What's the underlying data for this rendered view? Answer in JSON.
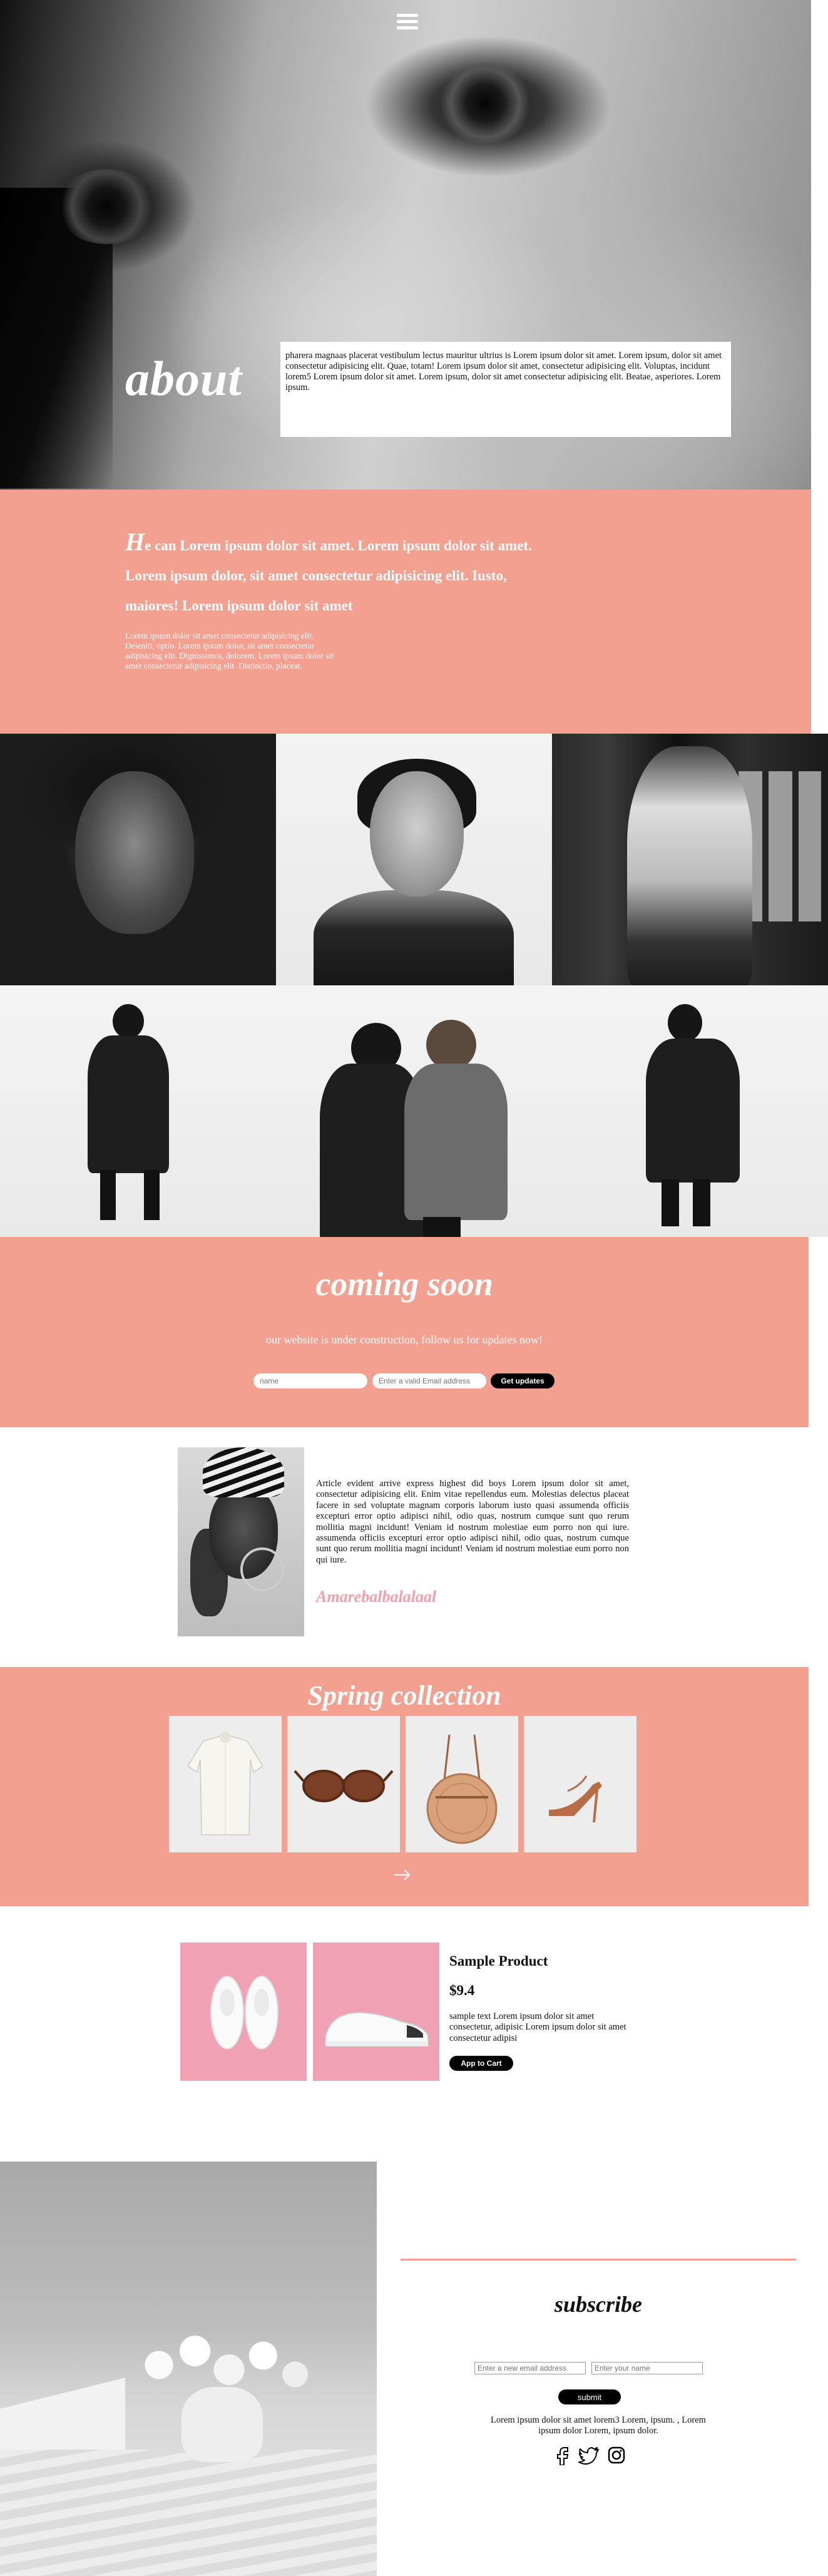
{
  "hero": {
    "title": "about",
    "body": "pharera magnaas placerat vestibulum lectus mauritur ultrius is Lorem ipsum dolor sit amet. Lorem ipsum, dolor sit amet consectetur adipisicing elit. Quae, totam! Lorem ipsum dolor sit amet, consectetur adipisicing elit. Voluptas, incidunt lorem5 Lorem ipsum dolor sit amet. Lorem ipsum, dolor sit amet consectetur adipisicing elit. Beatae, asperiores. Lorem ipsum."
  },
  "intro": {
    "dropcap": "H",
    "lead": "e can Lorem ipsum dolor sit amet. Lorem ipsum dolor sit amet. Lorem ipsum dolor, sit amet consectetur adipisicing elit. Iusto, maiores! Lorem ipsum dolor sit amet",
    "small": "Lorem ipsum dolor sit amet consectetur adipisicing elit. Deleniti, optio. Lorem ipsum dolor, sit amet consectetur adipisicing elit. Dignissimos, dolorem. Lorem ipsum dolor sit amet consectetur adipisicing elit. Distinctio, placeat."
  },
  "coming_soon": {
    "title": "coming soon",
    "subtitle": "our website is under construction, follow us for updates now!",
    "name_placeholder": "name",
    "email_placeholder": "Enter a valid Email address",
    "button": "Get updates"
  },
  "article": {
    "text": "Article evident arrive express highest did boys Lorem ipsum dolor sit amet, consectetur adipisicing elit. Enim vitae repellendus eum. Molestias delectus placeat facere in sed voluptate magnam corporis laborum iusto quasi assumenda officiis excepturi error optio adipisci nihil, odio quas, nostrum cumque sunt quo rerum mollitia magni incidunt! Veniam id nostrum molestiae eum porro non qui iure. assumenda officiis excepturi error optio adipisci nihil, odio quas, nostrum cumque sunt quo rerum mollitia magni incidunt! Veniam id nostrum molestiae eum porro non qui iure.",
    "signature": "Amarebalbalalaal"
  },
  "spring": {
    "title": "Spring collection"
  },
  "product": {
    "title": "Sample Product",
    "price": "$9.4",
    "description": "sample text Lorem ipsum dolor sit amet consectetur, adipisic Lorem ipsum dolor sit amet consectetur adipisi",
    "button": "App to Cart"
  },
  "subscribe": {
    "title": "subscribe",
    "email_placeholder": "Enter a new email address",
    "name_placeholder": "Enter your name",
    "button": "submit",
    "text": "Lorem ipsum dolor sit amet lorem3 Lorem, ipsum. , Lorem ipsum dolor Lorem, ipsum dolor."
  },
  "icons": {
    "menu": "hamburger-menu-icon",
    "arrow": "arrow-right-icon",
    "social": [
      "facebook-icon",
      "twitter-icon",
      "instagram-icon"
    ]
  },
  "colors": {
    "accent": "#f3a090",
    "signature": "#f5a0a8",
    "shoe_bg": "#f0a2b4",
    "button": "#000000"
  }
}
